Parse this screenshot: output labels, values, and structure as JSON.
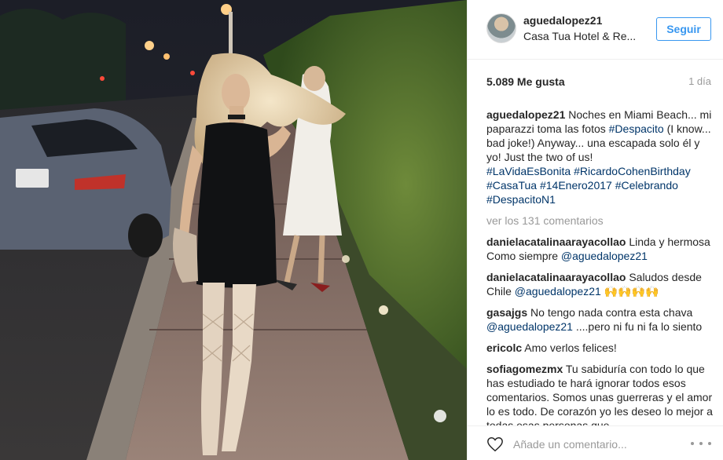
{
  "post": {
    "username": "aguedalopez21",
    "location": "Casa Tua Hotel & Re...",
    "follow_label": "Seguir",
    "likes": "5.089 Me gusta",
    "time": "1 día"
  },
  "caption": {
    "user": "aguedalopez21",
    "text_1": " Noches en Miami Beach... mi paparazzi toma las fotos ",
    "tag_1": "#Despacito",
    "text_2": " (I know... bad joke!) Anyway... una escapada solo él y yo! Just the two of us! ",
    "tags": [
      "#LaVidaEsBonita",
      "#RicardoCohenBirthday",
      "#CasaTua",
      "#14Enero2017",
      "#Celebrando",
      "#DespacitoN1"
    ]
  },
  "view_all": "ver los 131 comentarios",
  "comments": [
    {
      "user": "danielacatalinaarayacollao",
      "text": " Linda y hermosa Como siempre ",
      "mention": "@aguedalopez21",
      "after": ""
    },
    {
      "user": "danielacatalinaarayacollao",
      "text": " Saludos desde Chile ",
      "mention": "@aguedalopez21",
      "after": " 🙌🙌🙌🙌"
    },
    {
      "user": "gasajgs",
      "text": " No tengo nada contra esta chava ",
      "mention": "@aguedalopez21",
      "after": " ....pero ni fu ni fa lo siento"
    },
    {
      "user": "ericolc",
      "text": " Amo verlos felices!",
      "mention": "",
      "after": ""
    },
    {
      "user": "sofiagomezmx",
      "text": " Tu sabiduría con todo lo que has estudiado te hará ignorar todos esos comentarios. Somos unas guerreras y el amor lo es todo. De corazón yo les deseo lo mejor a todas esas personas que",
      "mention": "",
      "after": ""
    }
  ],
  "footer": {
    "placeholder": "Añade un comentario...",
    "heart_icon": "heart-icon",
    "more_icon": "more-options-icon"
  },
  "colors": {
    "link": "#003569",
    "follow": "#3897f0",
    "muted": "#999999"
  }
}
